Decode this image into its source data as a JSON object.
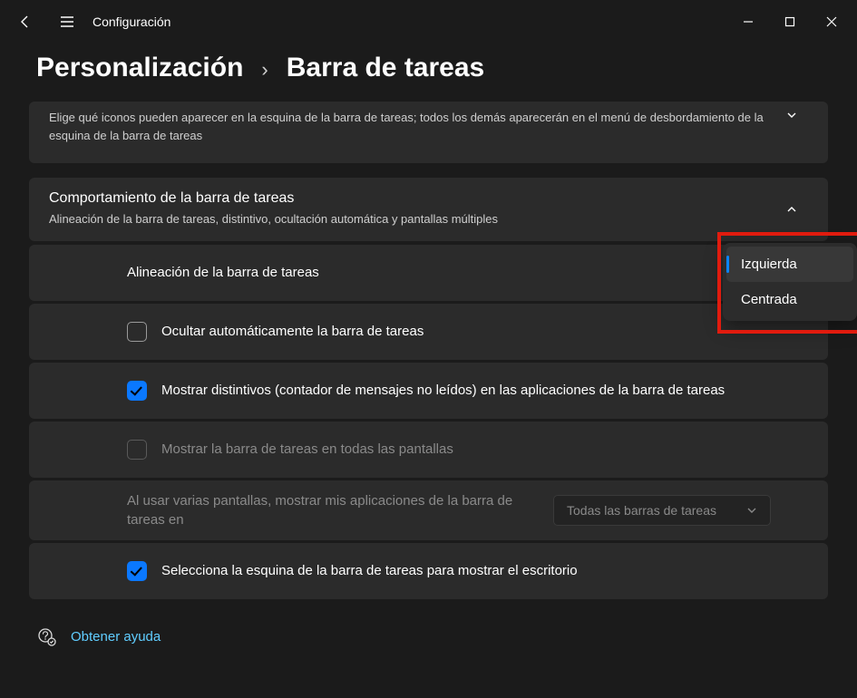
{
  "titlebar": {
    "title": "Configuración"
  },
  "breadcrumb": {
    "parent": "Personalización",
    "sep": "›",
    "current": "Barra de tareas"
  },
  "overflow_card": {
    "description": "Elige qué iconos pueden aparecer en la esquina de la barra de tareas; todos los demás aparecerán en el menú de desbordamiento de la esquina de la barra de tareas"
  },
  "behavior_card": {
    "title": "Comportamiento de la barra de tareas",
    "subtitle": "Alineación de la barra de tareas, distintivo, ocultación automática y pantallas múltiples"
  },
  "rows": {
    "alignment": {
      "label": "Alineación de la barra de tareas"
    },
    "autohide": {
      "label": "Ocultar automáticamente la barra de tareas"
    },
    "badges": {
      "label": "Mostrar distintivos (contador de mensajes no leídos) en las aplicaciones de la barra de tareas"
    },
    "all_displays": {
      "label": "Mostrar la barra de tareas en todas las pantallas"
    },
    "multi_display": {
      "label": "Al usar varias pantallas, mostrar mis aplicaciones de la barra de tareas en",
      "dropdown": "Todas las barras de tareas"
    },
    "desktop_corner": {
      "label": "Selecciona la esquina de la barra de tareas para mostrar el escritorio"
    }
  },
  "alignment_popup": {
    "options": [
      "Izquierda",
      "Centrada"
    ],
    "selected": "Izquierda"
  },
  "help": {
    "label": "Obtener ayuda"
  }
}
